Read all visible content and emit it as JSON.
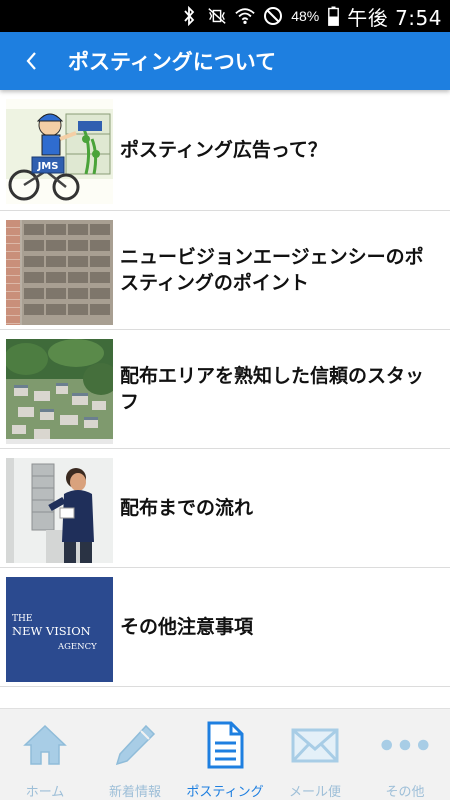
{
  "status_bar": {
    "battery_percent": "48%",
    "time": "午後 7:54",
    "icons": [
      "bluetooth-icon",
      "vibrate-mute-icon",
      "wifi-icon",
      "do-not-disturb-icon",
      "battery-icon"
    ]
  },
  "header": {
    "title": "ポスティングについて",
    "background_color": "#1e7fe0"
  },
  "list": {
    "items": [
      {
        "label": "ポスティング広告って？",
        "thumbnail": "delivery-bicycle-illustration"
      },
      {
        "label": "ニュービジョンエージェンシーのポスティングのポイント",
        "thumbnail": "mailboxes-photo"
      },
      {
        "label": "配布エリアを熟知した信頼のスタッフ",
        "thumbnail": "aerial-town-photo"
      },
      {
        "label": "配布までの流れ",
        "thumbnail": "staff-at-mailbox-photo"
      },
      {
        "label": "その他注意事項",
        "thumbnail": "company-logo"
      }
    ],
    "logo_text": {
      "line1": "THE",
      "line2": "NEW VISION",
      "line3": "AGENCY"
    },
    "jms_text": "JMS"
  },
  "bottom_nav": {
    "items": [
      {
        "label": "ホーム",
        "icon": "home-icon",
        "active": false
      },
      {
        "label": "新着情報",
        "icon": "pencil-icon",
        "active": false
      },
      {
        "label": "ポスティング",
        "icon": "document-icon",
        "active": true
      },
      {
        "label": "メール便",
        "icon": "mail-icon",
        "active": false
      },
      {
        "label": "その他",
        "icon": "more-icon",
        "active": false
      }
    ],
    "active_color": "#1e7fe0",
    "inactive_color": "#9ebfd8"
  }
}
